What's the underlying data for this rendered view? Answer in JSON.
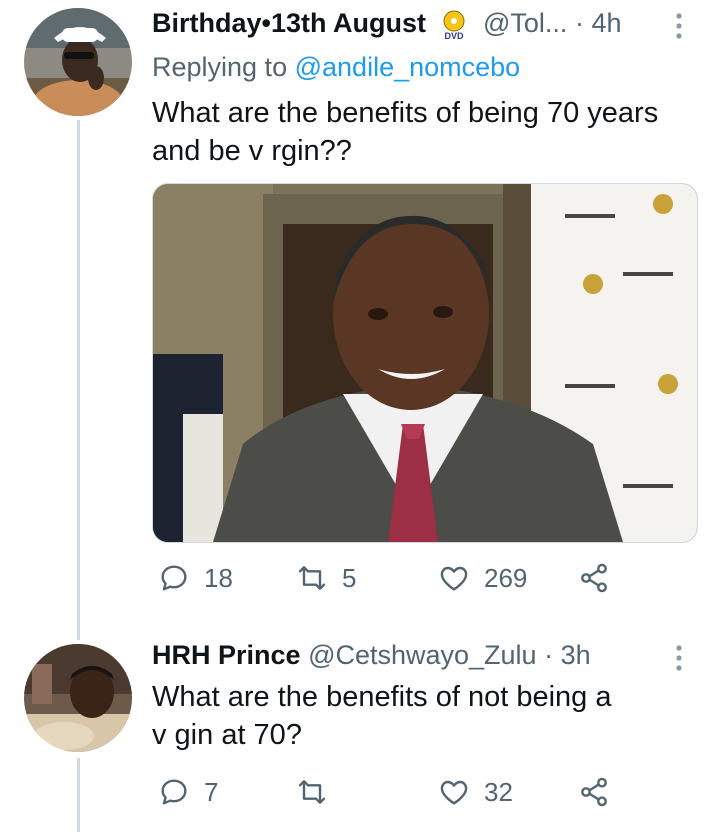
{
  "tweets": [
    {
      "name": "Birthday•13th August",
      "badge_icon": "dvd-badge-icon",
      "handle": "@Tol...",
      "time": "· 4h",
      "replying_label": "Replying to",
      "replying_to": "@andile_nomcebo",
      "text_line1": "What are the benefits of being 70 years",
      "text_line2": "and be v  rgin??",
      "stats": {
        "replies": "18",
        "retweets": "5",
        "likes": "269"
      }
    },
    {
      "name": "HRH Prince",
      "handle": "@Cetshwayo_Zulu",
      "time": "· 3h",
      "text_line1": "What are the benefits of not being a",
      "text_line2": "v  gin at 70?",
      "stats": {
        "replies": "7",
        "retweets": "",
        "likes": "32"
      }
    }
  ],
  "colors": {
    "link": "#1d9bf0",
    "secondary_text": "#536471",
    "thread_line": "#cfd9de"
  }
}
